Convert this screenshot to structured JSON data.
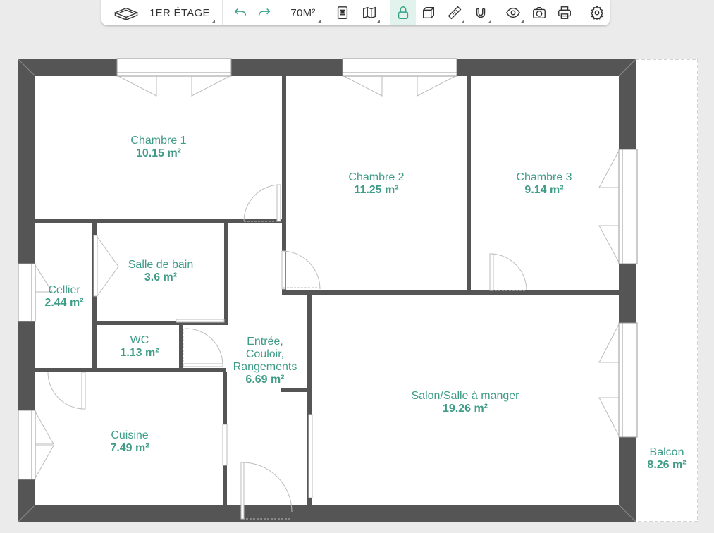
{
  "toolbar": {
    "floor_label": "1ER ÉTAGE",
    "area_label": "70M²",
    "icons": [
      "floor-3d-icon",
      "undo-icon",
      "redo-icon",
      "document-icon",
      "map-icon",
      "lock-icon",
      "cube-icon",
      "ruler-icon",
      "magnet-icon",
      "eye-icon",
      "camera-icon",
      "print-icon",
      "gear-icon"
    ]
  },
  "rooms": {
    "chambre1": {
      "name": "Chambre 1",
      "area": "10.15 m²"
    },
    "chambre2": {
      "name": "Chambre 2",
      "area": "11.25 m²"
    },
    "chambre3": {
      "name": "Chambre 3",
      "area": "9.14 m²"
    },
    "salle_de_bain": {
      "name": "Salle de bain",
      "area": "3.6 m²"
    },
    "cellier": {
      "name": "Cellier",
      "area": "2.44 m²"
    },
    "wc": {
      "name": "WC",
      "area": "1.13 m²"
    },
    "entree": {
      "name1": "Entrée,",
      "name2": "Couloir,",
      "name3": "Rangements",
      "area": "6.69 m²"
    },
    "cuisine": {
      "name": "Cuisine",
      "area": "7.49 m²"
    },
    "salon": {
      "name": "Salon/Salle à manger",
      "area": "19.26 m²"
    },
    "balcon": {
      "name": "Balcon",
      "area": "8.26 m²"
    }
  },
  "colors": {
    "wall": "#555555",
    "accent": "#3e9c87",
    "floor": "#ffffff",
    "background": "#ebebeb"
  }
}
